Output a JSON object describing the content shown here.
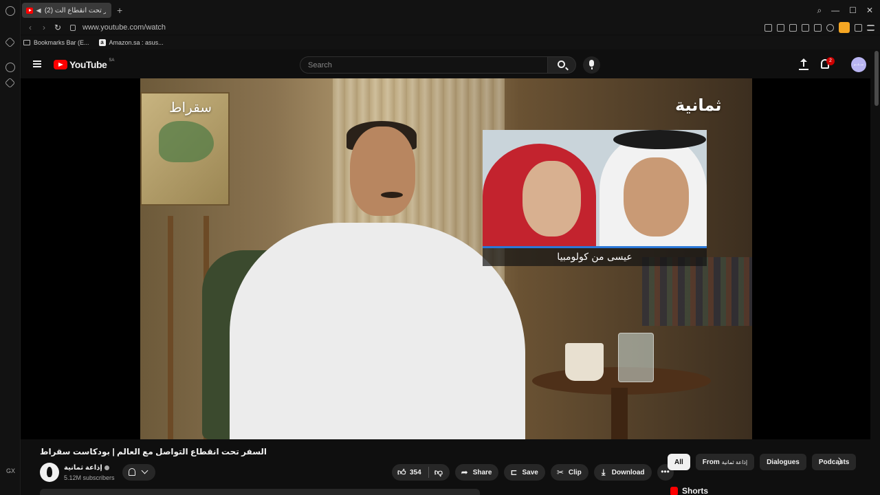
{
  "browser": {
    "tab_title": "(2) السفر تحت انقطاع الت",
    "url": "www.youtube.com/watch",
    "bookmarks": [
      {
        "label": "Bookmarks Bar (E..."
      },
      {
        "label": "Amazon.sa : asus..."
      }
    ],
    "rail_label": "GX"
  },
  "youtube": {
    "logo_text": "YouTube",
    "region": "SA",
    "search_placeholder": "Search",
    "notification_count": "2",
    "avatar_text": "ســـلـــم"
  },
  "video": {
    "overlay_left": "سقراط",
    "overlay_right": "ثمانية",
    "inset_caption": "عيسى من كولومبيا",
    "title": "السفر تحت انقطاع التواصل مع العالم | بودكاست سقراط"
  },
  "channel": {
    "name": "إذاعة ثمانية",
    "subscribers": "5.12M subscribers"
  },
  "actions": {
    "likes": "354",
    "share": "Share",
    "save": "Save",
    "clip": "Clip",
    "download": "Download"
  },
  "chips": {
    "all": "All",
    "from_prefix": "From",
    "from_channel": "إذاعة ثمانية",
    "dialogues": "Dialogues",
    "podcasts": "Podcasts"
  },
  "shorts_label": "Shorts",
  "colors": {
    "background": "#0f0f0f",
    "brand_red": "#ff0000",
    "pill": "#272727",
    "text": "#f1f1f1"
  }
}
